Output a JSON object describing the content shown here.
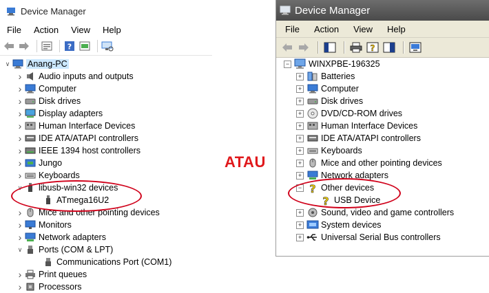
{
  "left": {
    "title": "Device Manager",
    "menu": [
      "File",
      "Action",
      "View",
      "Help"
    ],
    "root": "Anang-PC",
    "items": [
      {
        "label": "Audio inputs and outputs",
        "icon": "speaker-icon",
        "expanded": false
      },
      {
        "label": "Computer",
        "icon": "computer-icon",
        "expanded": false
      },
      {
        "label": "Disk drives",
        "icon": "disk-icon",
        "expanded": false
      },
      {
        "label": "Display adapters",
        "icon": "display-icon",
        "expanded": false
      },
      {
        "label": "Human Interface Devices",
        "icon": "hid-icon",
        "expanded": false
      },
      {
        "label": "IDE ATA/ATAPI controllers",
        "icon": "ide-icon",
        "expanded": false
      },
      {
        "label": "IEEE 1394 host controllers",
        "icon": "ieee-icon",
        "expanded": false
      },
      {
        "label": "Jungo",
        "icon": "jungo-icon",
        "expanded": false
      },
      {
        "label": "Keyboards",
        "icon": "keyboard-icon",
        "expanded": false
      },
      {
        "label": "libusb-win32 devices",
        "icon": "usb-plug-icon",
        "expanded": true,
        "children": [
          "ATmega16U2"
        ]
      },
      {
        "label": "Mice and other pointing devices",
        "icon": "mouse-icon",
        "expanded": false
      },
      {
        "label": "Monitors",
        "icon": "monitor-icon",
        "expanded": false
      },
      {
        "label": "Network adapters",
        "icon": "network-icon",
        "expanded": false
      },
      {
        "label": "Ports (COM & LPT)",
        "icon": "port-icon",
        "expanded": true,
        "children": [
          "Communications Port (COM1)"
        ]
      },
      {
        "label": "Print queues",
        "icon": "printer-icon",
        "expanded": false
      },
      {
        "label": "Processors",
        "icon": "cpu-icon",
        "expanded": false
      }
    ]
  },
  "separator_text": "ATAU",
  "right": {
    "title": "Device Manager",
    "menu": [
      "File",
      "Action",
      "View",
      "Help"
    ],
    "root": "WINXPBE-196325",
    "items": [
      {
        "label": "Batteries",
        "icon": "battery-icon",
        "expanded": false
      },
      {
        "label": "Computer",
        "icon": "computer-icon",
        "expanded": false
      },
      {
        "label": "Disk drives",
        "icon": "disk-icon",
        "expanded": false
      },
      {
        "label": "DVD/CD-ROM drives",
        "icon": "cdrom-icon",
        "expanded": false
      },
      {
        "label": "Human Interface Devices",
        "icon": "hid-icon",
        "expanded": false
      },
      {
        "label": "IDE ATA/ATAPI controllers",
        "icon": "ide-icon",
        "expanded": false
      },
      {
        "label": "Keyboards",
        "icon": "keyboard-icon",
        "expanded": false
      },
      {
        "label": "Mice and other pointing devices",
        "icon": "mouse-icon",
        "expanded": false
      },
      {
        "label": "Network adapters",
        "icon": "network-icon",
        "expanded": false
      },
      {
        "label": "Other devices",
        "icon": "unknown-device-icon",
        "expanded": true,
        "children": [
          "USB Device"
        ]
      },
      {
        "label": "Sound, video and game controllers",
        "icon": "sound-icon",
        "expanded": false
      },
      {
        "label": "System devices",
        "icon": "system-icon",
        "expanded": false
      },
      {
        "label": "Universal Serial Bus controllers",
        "icon": "usb-icon",
        "expanded": false
      }
    ]
  },
  "colors": {
    "highlight_ellipse": "#d0021b",
    "atau_text": "#e0191c",
    "xp_title_bar": "#555555",
    "xp_menu_bg": "#ece9d8",
    "root_selection": "#cce8ff"
  }
}
